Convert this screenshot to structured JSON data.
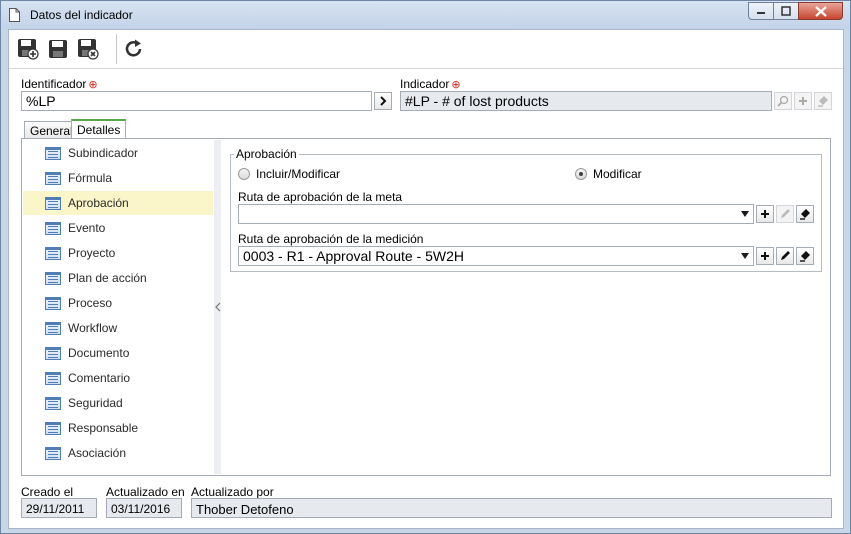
{
  "window": {
    "title": "Datos del indicador",
    "icon": "document-icon"
  },
  "toolbar": {
    "buttons": [
      {
        "name": "save-new",
        "icon": "save-new-icon"
      },
      {
        "name": "save",
        "icon": "save-icon"
      },
      {
        "name": "save-close",
        "icon": "save-close-icon"
      },
      {
        "name": "refresh",
        "icon": "refresh-icon"
      }
    ]
  },
  "form": {
    "identificador_label": "Identificador",
    "identificador_value": "%LP",
    "indicador_label": "Indicador",
    "indicador_value": "#LP - # of lost products"
  },
  "tabs": [
    {
      "label": "General",
      "active": false
    },
    {
      "label": "Detalles",
      "active": true
    }
  ],
  "sidebar": {
    "items": [
      {
        "label": "Subindicador",
        "selected": false
      },
      {
        "label": "Fórmula",
        "selected": false
      },
      {
        "label": "Aprobación",
        "selected": true
      },
      {
        "label": "Evento",
        "selected": false
      },
      {
        "label": "Proyecto",
        "selected": false
      },
      {
        "label": "Plan de acción",
        "selected": false
      },
      {
        "label": "Proceso",
        "selected": false
      },
      {
        "label": "Workflow",
        "selected": false
      },
      {
        "label": "Documento",
        "selected": false
      },
      {
        "label": "Comentario",
        "selected": false
      },
      {
        "label": "Seguridad",
        "selected": false
      },
      {
        "label": "Responsable",
        "selected": false
      },
      {
        "label": "Asociación",
        "selected": false
      }
    ]
  },
  "approval": {
    "group_title": "Aprobación",
    "radio_include": "Incluir/Modificar",
    "radio_modify": "Modificar",
    "selected": "Modificar",
    "meta_label": "Ruta de aprobación de la meta",
    "meta_value": "",
    "medicion_label": "Ruta de aprobación de la medición",
    "medicion_value": "0003 - R1 - Approval Route - 5W2H"
  },
  "footer": {
    "created_label": "Creado el",
    "created_value": "29/11/2011",
    "updated_label": "Actualizado en",
    "updated_value": "03/11/2016",
    "updated_by_label": "Actualizado por",
    "updated_by_value": "Thober Detofeno"
  },
  "colors": {
    "selected_row": "#fbf6c9",
    "active_tab_accent": "#5aa64a",
    "required_mark": "#d9261c",
    "close_button": "#c7452f"
  }
}
